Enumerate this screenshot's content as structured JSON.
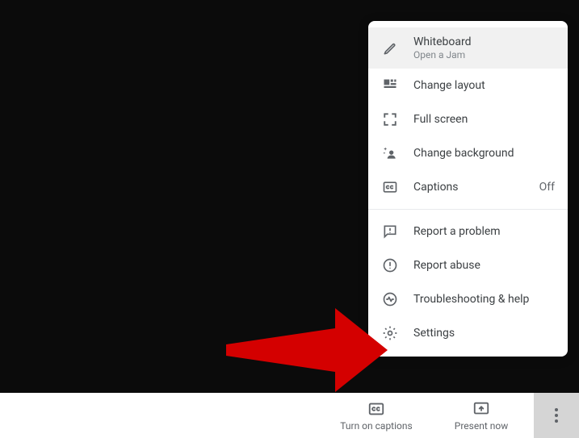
{
  "menu": {
    "whiteboard": {
      "label": "Whiteboard",
      "sub": "Open a Jam"
    },
    "layout": {
      "label": "Change layout"
    },
    "fullscreen": {
      "label": "Full screen"
    },
    "background": {
      "label": "Change background"
    },
    "captions": {
      "label": "Captions",
      "state": "Off"
    },
    "report_problem": {
      "label": "Report a problem"
    },
    "report_abuse": {
      "label": "Report abuse"
    },
    "troubleshoot": {
      "label": "Troubleshooting & help"
    },
    "settings": {
      "label": "Settings"
    }
  },
  "bar": {
    "captions_label": "Turn on captions",
    "present_label": "Present now"
  }
}
